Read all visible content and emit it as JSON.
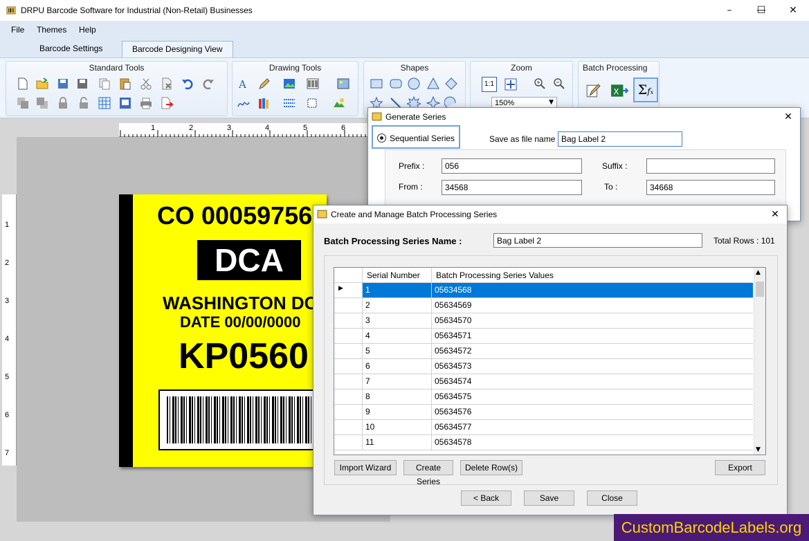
{
  "window": {
    "title": "DRPU Barcode Software for Industrial (Non-Retail) Businesses"
  },
  "menu": [
    "File",
    "Themes",
    "Help"
  ],
  "tabs": [
    "Barcode Settings",
    "Barcode Designing View"
  ],
  "ribbon": {
    "standard_tools": "Standard Tools",
    "drawing_tools": "Drawing Tools",
    "shapes": "Shapes",
    "zoom": "Zoom",
    "zoom_value": "150%",
    "zoom_fit": "1:1",
    "batch_processing": "Batch Processing"
  },
  "ruler": {
    "top": [
      "1",
      "2",
      "3",
      "4",
      "5",
      "6"
    ],
    "left": [
      "1",
      "2",
      "3",
      "4",
      "5",
      "6",
      "7"
    ]
  },
  "label": {
    "line1": "CO 00059756",
    "box_text": "DCA",
    "city": "WASHINGTON DC",
    "date": "DATE 00/00/0000",
    "code": "KP0560"
  },
  "generate_series": {
    "title": "Generate Series",
    "sequential_series": "Sequential Series",
    "save_as_label": "Save as file name :",
    "save_as_value": "Bag Label 2",
    "prefix_label": "Prefix :",
    "prefix_value": "056",
    "suffix_label": "Suffix :",
    "suffix_value": "",
    "from_label": "From :",
    "from_value": "34568",
    "to_label": "To :",
    "to_value": "34668"
  },
  "batch_dialog": {
    "title": "Create and Manage Batch Processing Series",
    "series_name_label": "Batch Processing Series Name :",
    "series_name_value": "Bag Label 2",
    "total_rows": "Total Rows : 101",
    "columns": [
      "Serial Number",
      "Batch Processing Series Values"
    ],
    "rows": [
      [
        "1",
        "05634568"
      ],
      [
        "2",
        "05634569"
      ],
      [
        "3",
        "05634570"
      ],
      [
        "4",
        "05634571"
      ],
      [
        "5",
        "05634572"
      ],
      [
        "6",
        "05634573"
      ],
      [
        "7",
        "05634574"
      ],
      [
        "8",
        "05634575"
      ],
      [
        "9",
        "05634576"
      ],
      [
        "10",
        "05634577"
      ],
      [
        "11",
        "05634578"
      ]
    ],
    "buttons": {
      "import_wizard": "Import Wizard",
      "create_series": "Create Series",
      "delete_rows": "Delete Row(s)",
      "export": "Export",
      "back": "< Back",
      "save": "Save",
      "close": "Close"
    }
  },
  "watermark": "CustomBarcodeLabels.org"
}
